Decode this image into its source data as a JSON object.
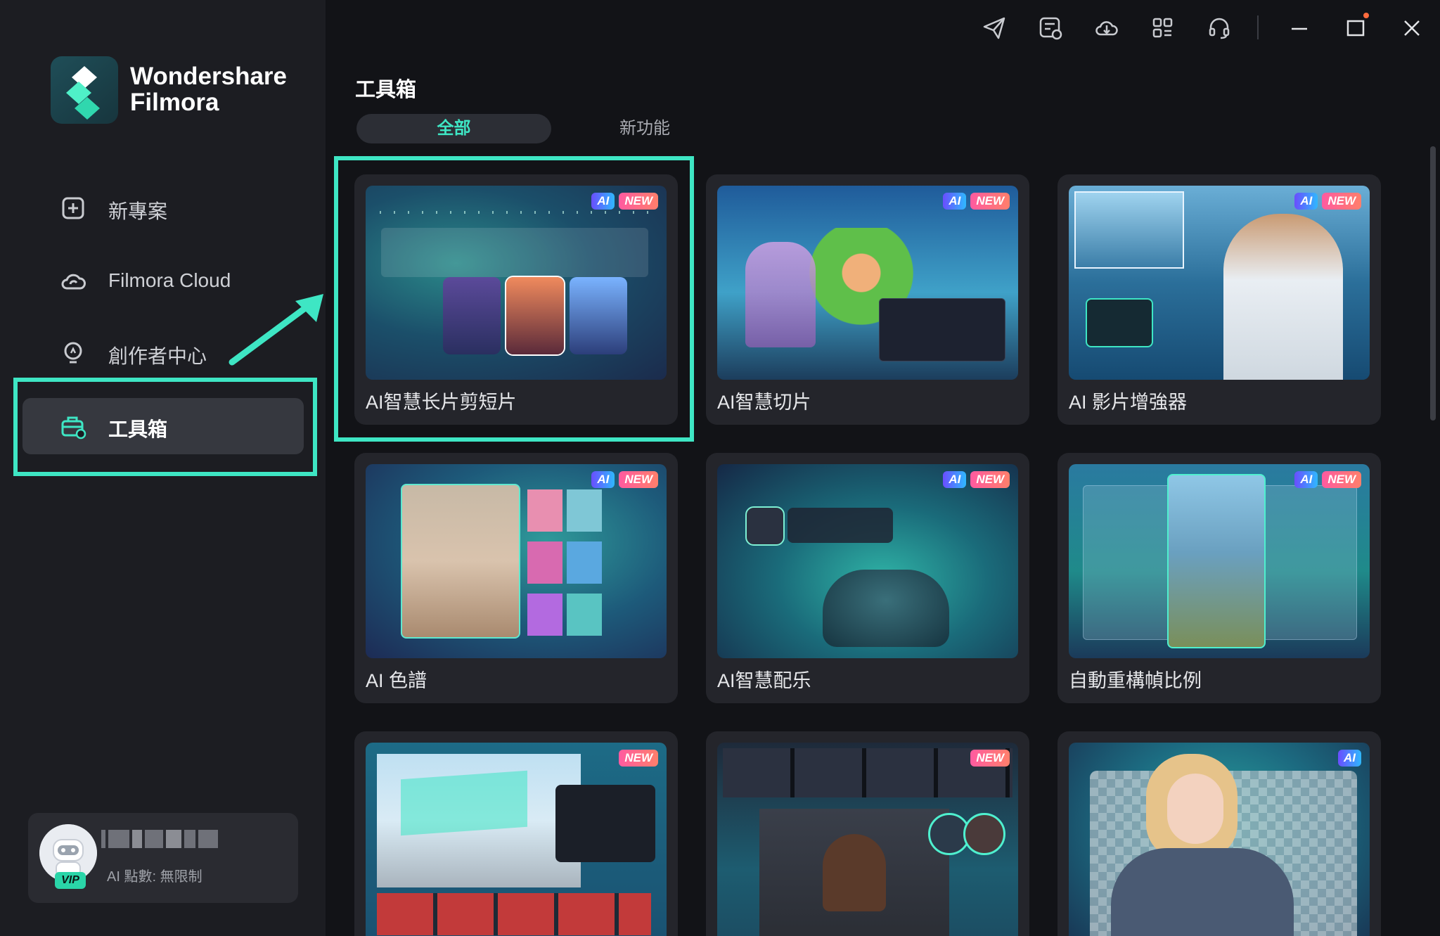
{
  "app": {
    "brand_line1": "Wondershare",
    "brand_line2": "Filmora"
  },
  "sidebar": {
    "items": [
      {
        "label": "新專案",
        "icon": "plus-square-icon"
      },
      {
        "label": "Filmora Cloud",
        "icon": "cloud-icon"
      },
      {
        "label": "創作者中心",
        "icon": "lightbulb-icon"
      },
      {
        "label": "工具箱",
        "icon": "toolbox-icon",
        "active": true
      }
    ]
  },
  "user": {
    "vip": "VIP",
    "ai_points": "AI 點數: 無限制"
  },
  "titlebar": {
    "icons": [
      "send-icon",
      "task-list-icon",
      "cloud-sync-icon",
      "apps-grid-icon",
      "headset-icon",
      "minimize-icon",
      "maximize-icon",
      "close-icon"
    ]
  },
  "main": {
    "title": "工具箱",
    "tabs": [
      {
        "label": "全部",
        "active": true
      },
      {
        "label": "新功能",
        "active": false
      }
    ]
  },
  "cards": [
    {
      "title": "AI智慧长片剪短片",
      "badges": [
        "AI",
        "NEW"
      ]
    },
    {
      "title": "AI智慧切片",
      "badges": [
        "AI",
        "NEW"
      ]
    },
    {
      "title": "AI 影片增強器",
      "badges": [
        "AI",
        "NEW"
      ]
    },
    {
      "title": "AI 色譜",
      "badges": [
        "AI",
        "NEW"
      ]
    },
    {
      "title": "AI智慧配乐",
      "badges": [
        "AI",
        "NEW"
      ]
    },
    {
      "title": "自動重構幀比例",
      "badges": [
        "AI",
        "NEW"
      ]
    },
    {
      "title": "",
      "badges": [
        "NEW"
      ]
    },
    {
      "title": "",
      "badges": [
        "NEW"
      ]
    },
    {
      "title": "",
      "badges": [
        "AI"
      ]
    }
  ],
  "colors": {
    "accent": "#3ee6c4",
    "sidebar_bg": "#1c1d22",
    "main_bg": "#121317",
    "card_bg": "#24252b"
  }
}
